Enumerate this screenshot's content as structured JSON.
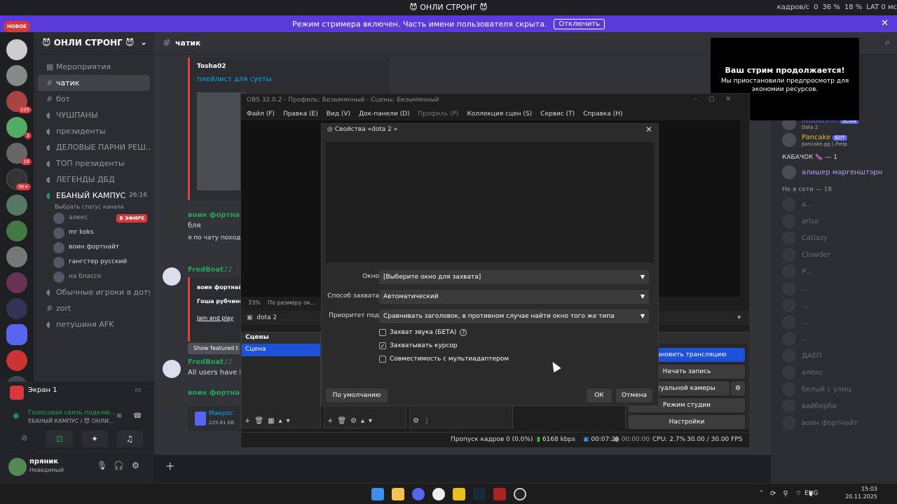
{
  "window_title": "😈 ОНЛИ СТРОНГ 😈",
  "top_stats": {
    "fps_label": "кадров/с",
    "fps": "0",
    "cpu": "36 %",
    "gpu": "18 %",
    "lat": "LAT 0 мс"
  },
  "banner": {
    "text": "Режим стримера включен. Часть имени пользователя скрыта.",
    "button": "Отключить"
  },
  "server_badges": {
    "new": "НОВОЕ",
    "b1": "105",
    "b2": "3",
    "b3": "16",
    "b4": "9K+"
  },
  "guild": {
    "name": "😈 ОНЛИ СТРОНГ 😈"
  },
  "channels": [
    {
      "label": "Мероприятия"
    },
    {
      "label": "чатик"
    },
    {
      "label": "бот"
    },
    {
      "label": "ЧУШПАНЫ"
    },
    {
      "label": "президенты"
    },
    {
      "label": "ДЕЛОВЫЕ ПАРНИ РЕШ..."
    },
    {
      "label": "ТОП президенты"
    },
    {
      "label": "ЛЕГЕНДЫ ДБД"
    },
    {
      "label": "ЕБАНЫЙ КАМПУС",
      "time": "26:16",
      "status": "Выбрать статус канала"
    }
  ],
  "voice_users": [
    {
      "name": "алекс",
      "live": "В ЭФИРЕ"
    },
    {
      "name": "mr koks"
    },
    {
      "name": "воин фортнайт"
    },
    {
      "name": "гангстер русский"
    },
    {
      "name": "на блассе"
    }
  ],
  "channels2": [
    {
      "label": "Обычные игроки в доту"
    },
    {
      "label": "zort"
    },
    {
      "label": "петушиня AFK"
    }
  ],
  "screen_share": {
    "label": "Экран 1"
  },
  "voice_status": {
    "title": "Голосовая связь подклю...",
    "sub": "ЕБАНЫЙ КАМПУС / 😈 ОНЛИ..."
  },
  "user": {
    "name": "пряник",
    "status": "Невидимый"
  },
  "chat": {
    "channel": "чатик",
    "messages": [
      {
        "name": "Tosha02",
        "text": "плейлист для суеты"
      },
      {
        "name": "воин фортнайт",
        "text": "бля"
      },
      {
        "name": "",
        "text": "я по чату походу"
      },
      {
        "name": "FredBoat♪♪",
        "text": "воин фортнайт"
      },
      {
        "name": "",
        "text": "Гоша рубчинск"
      },
      {
        "name": "",
        "text": "Jam and play"
      },
      {
        "name": "",
        "text": "Show featured t"
      },
      {
        "name": "FredBoat♪♪",
        "text": "All users have le"
      },
      {
        "name": "воин фортнайт",
        "text": ""
      },
      {
        "name": "",
        "text": "Макрос",
        "size": "229.81 KB"
      }
    ]
  },
  "overlay": {
    "title": "Ваш стрим продолжается!",
    "text": "Мы приостановили предпросмотр для экономии ресурсов."
  },
  "members": {
    "online": [
      {
        "name": "mudazvon",
        "sub": "Dota 2",
        "tag": "SCAN"
      },
      {
        "name": "Pancake",
        "sub": "pancake.gg | /help",
        "tag": "БОТ"
      }
    ],
    "group_label": "КАБАЧОК 🍆 — 1",
    "group_member": "алишер маргенштэрн",
    "offline_label": "Не в сети — 18",
    "offline": [
      "а...",
      "artur",
      "Catlazy",
      "Clowder",
      "Р...",
      "...",
      "...",
      "...",
      "...",
      "ДАЕП",
      "алекс",
      "белый с улиц",
      "вайберби",
      "воин фортнайт"
    ]
  },
  "obs": {
    "title": "OBS 32.0.2 - Профиль: Безымянный - Сцены: Безымянный",
    "menu": [
      "Файл (F)",
      "Правка (E)",
      "Вид (V)",
      "Док-панели (D)",
      "Профиль (P)",
      "Коллекция сцен (S)",
      "Сервис (T)",
      "Справка (H)"
    ],
    "zoom": "33%",
    "zoom_mode": "По размеру ок...",
    "source": "dota 2",
    "scenes_header": "Сцены",
    "scene": "Сцена",
    "controls_header": "...ие",
    "buttons": [
      "...тановить трансляцию",
      "Начать запись",
      "...иртуальной камеры",
      "Режим студии",
      "Настройки"
    ],
    "status": {
      "dropped": "Пропуск кадров 0 (0.0%)",
      "kbps": "6168 kbps",
      "time1": "00:07:21",
      "time2": "00:00:00",
      "cpu": "CPU: 2.7%",
      "fps": "30.00 / 30.00 FPS"
    }
  },
  "props": {
    "title": "Свойства «dota 2 »",
    "rows": [
      {
        "label": "Окно",
        "value": "[Выберите окно для захвата]"
      },
      {
        "label": "Способ захвата",
        "value": "Автоматический"
      },
      {
        "label": "Приоритет под",
        "value": "Сравнивать заголовок, в противном случае найти окно того же типа"
      }
    ],
    "checks": [
      {
        "label": "Захват звука (БЕТА)",
        "mark": ""
      },
      {
        "label": "Захватывать курсор",
        "mark": "✓"
      },
      {
        "label": "Совместимость с мультиадаптером",
        "mark": ""
      }
    ],
    "defaults": "По умолчанию",
    "ok": "ОК",
    "cancel": "Отмена"
  },
  "taskbar": {
    "lang": "ENG",
    "time": "15:03",
    "date": "20.11.2025"
  }
}
